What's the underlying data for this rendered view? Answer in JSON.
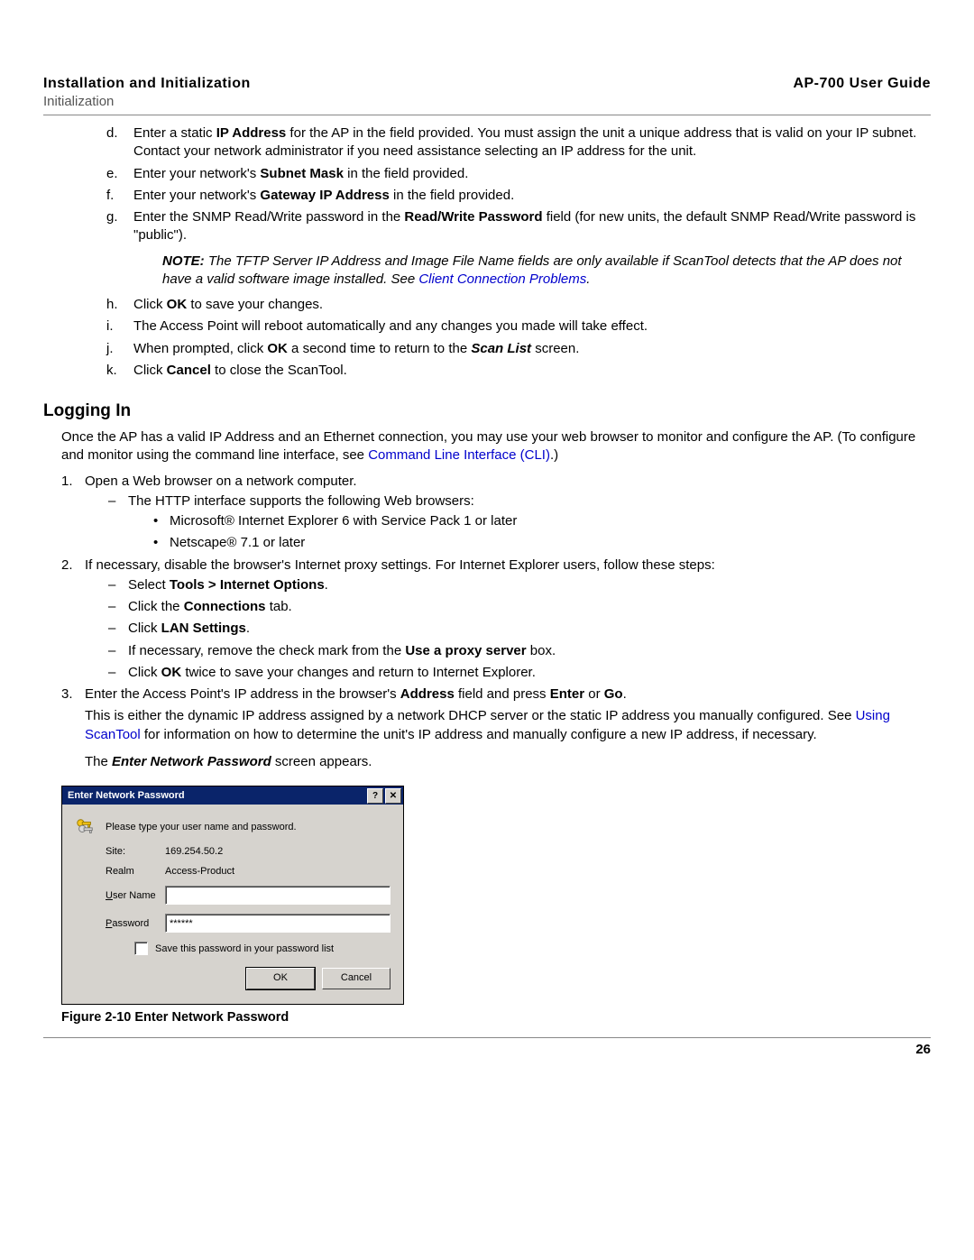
{
  "header": {
    "left": "Installation and Initialization",
    "right": "AP-700 User Guide",
    "sub": "Initialization"
  },
  "steps": {
    "d": {
      "pre": "Enter a static ",
      "b1": "IP Address",
      "post": " for the AP in the field provided. You must assign the unit a unique address that is valid on your IP subnet. Contact your network administrator if you need assistance selecting an IP address for the unit."
    },
    "e": {
      "pre": "Enter your network's ",
      "b1": "Subnet Mask",
      "post": " in the field provided."
    },
    "f": {
      "pre": "Enter your network's ",
      "b1": "Gateway IP Address",
      "post": " in the field provided."
    },
    "g": {
      "pre": "Enter the SNMP Read/Write password in the ",
      "b1": "Read/Write Password",
      "post": " field (for new units, the default SNMP Read/Write password is \"public\")."
    },
    "note": {
      "lead": "NOTE:",
      "body_pre": " The TFTP Server IP Address and Image File Name fields are only available if ScanTool detects that the AP does not have a valid software image installed. See ",
      "link": "Client Connection Problems",
      "tail": "."
    },
    "h": {
      "pre": "Click ",
      "b1": "OK",
      "post": " to save your changes."
    },
    "i": "The Access Point will reboot automatically and any changes you made will take effect.",
    "j": {
      "pre": "When prompted, click ",
      "b1": "OK",
      "mid": " a second time to return to the ",
      "i1": "Scan List",
      "post": " screen."
    },
    "k": {
      "pre": "Click ",
      "b1": "Cancel",
      "post": " to close the ScanTool."
    }
  },
  "logging": {
    "title": "Logging In",
    "intro_pre": "Once the AP has a valid IP Address and an Ethernet connection, you may use your web browser to monitor and configure the AP. (To configure and monitor using the command line interface, see ",
    "intro_link": "Command Line Interface (CLI)",
    "intro_post": ".)",
    "l1": "Open a Web browser on a network computer.",
    "l1a": "The HTTP interface supports the following Web browsers:",
    "l1a1": "Microsoft® Internet Explorer 6 with Service Pack 1 or later",
    "l1a2": "Netscape® 7.1 or later",
    "l2": "If necessary, disable the browser's Internet proxy settings. For Internet Explorer users, follow these steps:",
    "l2a_pre": "Select ",
    "l2a_b": "Tools > Internet Options",
    "l2a_post": ".",
    "l2b_pre": "Click the ",
    "l2b_b": "Connections",
    "l2b_post": " tab.",
    "l2c_pre": "Click ",
    "l2c_b": "LAN Settings",
    "l2c_post": ".",
    "l2d_pre": "If necessary, remove the check mark from the ",
    "l2d_b": "Use a proxy server",
    "l2d_post": " box.",
    "l2e_pre": "Click ",
    "l2e_b": "OK",
    "l2e_post": " twice to save your changes and return to Internet Explorer.",
    "l3_pre": "Enter the Access Point's IP address in the browser's ",
    "l3_b1": "Address",
    "l3_mid": " field and press ",
    "l3_b2": "Enter",
    "l3_or": " or ",
    "l3_b3": "Go",
    "l3_post": ".",
    "l3p_pre": "This is either the dynamic IP address assigned by a network DHCP server or the static IP address you manually configured. See ",
    "l3p_link": "Using ScanTool",
    "l3p_post": " for information on how to determine the unit's IP address and manually configure a new IP address, if necessary.",
    "l3q_pre": "The ",
    "l3q_i": "Enter Network Password",
    "l3q_post": " screen appears."
  },
  "dialog": {
    "title": "Enter Network Password",
    "msg": "Please type your user name and password.",
    "site_lbl": "Site:",
    "site_val": "169.254.50.2",
    "realm_lbl": "Realm",
    "realm_val": "Access-Product",
    "user_lbl_pre": "U",
    "user_lbl_post": "ser Name",
    "pass_lbl_pre": "P",
    "pass_lbl_post": "assword",
    "pass_val": "******",
    "save_pre": "S",
    "save_post": "ave this password in your password list",
    "ok": "OK",
    "cancel": "Cancel"
  },
  "caption": "Figure 2-10 Enter Network Password",
  "page_number": "26"
}
